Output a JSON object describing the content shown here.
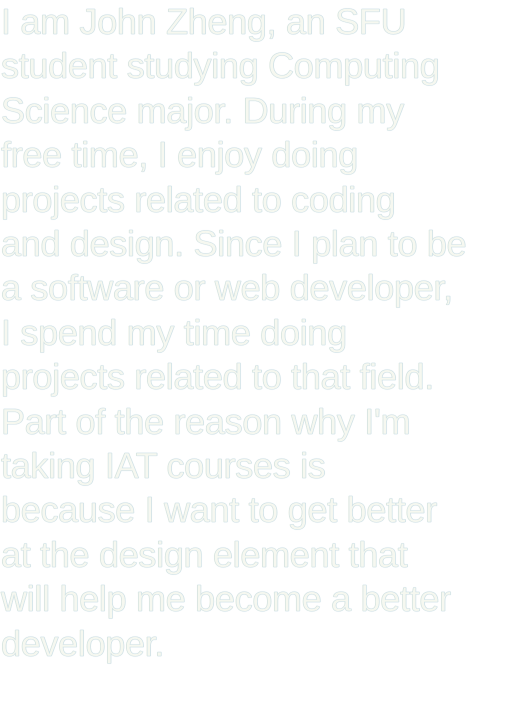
{
  "bio": {
    "lines": [
      "I am John Zheng, an SFU",
      "student studying Computing",
      "Science major. During my",
      "free time, I enjoy doing",
      "projects related to coding",
      "and design. Since I plan to be",
      "a software or web developer,",
      "I spend my time doing",
      "projects related to that field.",
      "Part of the reason why I'm",
      "taking IAT courses is",
      "because I want to get better",
      "at the design element that",
      "will help me become a better",
      "developer."
    ],
    "text_color": "#f6f8f0",
    "background": "#ffffff"
  }
}
